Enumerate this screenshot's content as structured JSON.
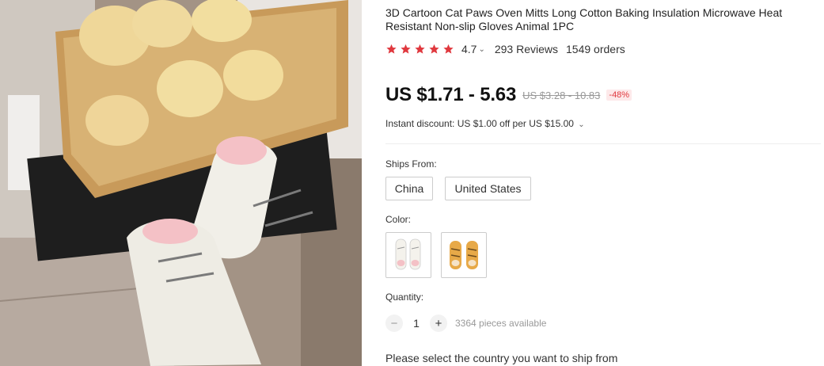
{
  "product": {
    "title": "3D Cartoon Cat Paws Oven Mitts Long Cotton Baking Insulation Microwave Heat Resistant Non-slip Gloves Animal 1PC",
    "image_alt": "cat paw oven mitts holding baking tray",
    "rating": "4.7",
    "stars": 5,
    "reviews": "293 Reviews",
    "orders": "1549 orders",
    "price": "US $1.71 - 5.63",
    "original_price": "US $3.28 - 10.83",
    "discount": "-48%",
    "instant_discount": "Instant discount: US $1.00 off per US $15.00"
  },
  "shipping": {
    "label": "Ships From:",
    "options": [
      "China",
      "United States"
    ]
  },
  "color": {
    "label": "Color:",
    "options": [
      "white-cat-paw",
      "tiger-cat-paw"
    ]
  },
  "quantity": {
    "label": "Quantity:",
    "value": "1",
    "minus": "−",
    "plus": "+",
    "available": "3364 pieces available"
  },
  "ship_message": "Please select the country you want to ship from",
  "icons": {
    "star": "star-icon",
    "chevron": "chevron-down-icon"
  },
  "colors": {
    "star": "#e0383e",
    "badge_text": "#e0383e",
    "badge_bg": "#fde9ea"
  }
}
